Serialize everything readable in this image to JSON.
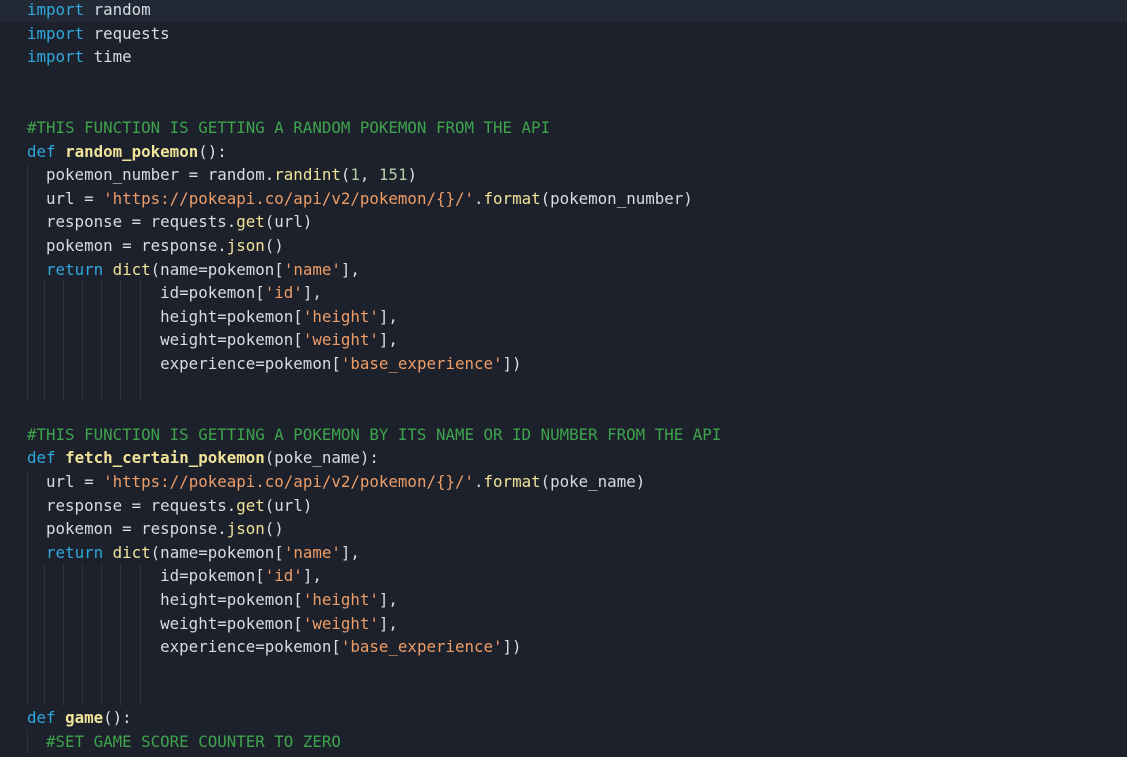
{
  "editor": {
    "lines": [
      [
        [
          "kw",
          "import"
        ],
        [
          "pl",
          " random"
        ]
      ],
      [
        [
          "kw",
          "import"
        ],
        [
          "pl",
          " requests"
        ]
      ],
      [
        [
          "kw",
          "import"
        ],
        [
          "pl",
          " time"
        ]
      ],
      [],
      [],
      [
        [
          "cmt",
          "#THIS FUNCTION IS GETTING A RANDOM POKEMON FROM THE API"
        ]
      ],
      [
        [
          "kw",
          "def"
        ],
        [
          "pl",
          " "
        ],
        [
          "fn",
          "random_pokemon"
        ],
        [
          "pl",
          "():"
        ]
      ],
      [
        [
          "pl",
          "  pokemon_number = random."
        ],
        [
          "meth",
          "randint"
        ],
        [
          "pl",
          "("
        ],
        [
          "num",
          "1"
        ],
        [
          "pl",
          ", "
        ],
        [
          "num",
          "151"
        ],
        [
          "pl",
          ")"
        ]
      ],
      [
        [
          "pl",
          "  url = "
        ],
        [
          "str",
          "'https://pokeapi.co/api/v2/pokemon/{}/'"
        ],
        [
          "pl",
          "."
        ],
        [
          "meth",
          "format"
        ],
        [
          "pl",
          "(pokemon_number)"
        ]
      ],
      [
        [
          "pl",
          "  response = requests."
        ],
        [
          "meth",
          "get"
        ],
        [
          "pl",
          "(url)"
        ]
      ],
      [
        [
          "pl",
          "  pokemon = response."
        ],
        [
          "meth",
          "json"
        ],
        [
          "pl",
          "()"
        ]
      ],
      [
        [
          "pl",
          "  "
        ],
        [
          "kw",
          "return"
        ],
        [
          "pl",
          " "
        ],
        [
          "meth",
          "dict"
        ],
        [
          "pl",
          "(name=pokemon["
        ],
        [
          "str",
          "'name'"
        ],
        [
          "pl",
          "],"
        ]
      ],
      [
        [
          "pl",
          "              id=pokemon["
        ],
        [
          "str",
          "'id'"
        ],
        [
          "pl",
          "],"
        ]
      ],
      [
        [
          "pl",
          "              height=pokemon["
        ],
        [
          "str",
          "'height'"
        ],
        [
          "pl",
          "],"
        ]
      ],
      [
        [
          "pl",
          "              weight=pokemon["
        ],
        [
          "str",
          "'weight'"
        ],
        [
          "pl",
          "],"
        ]
      ],
      [
        [
          "pl",
          "              experience=pokemon["
        ],
        [
          "str",
          "'base_experience'"
        ],
        [
          "pl",
          "])"
        ]
      ],
      [],
      [],
      [
        [
          "cmt",
          "#THIS FUNCTION IS GETTING A POKEMON BY ITS NAME OR ID NUMBER FROM THE API"
        ]
      ],
      [
        [
          "kw",
          "def"
        ],
        [
          "pl",
          " "
        ],
        [
          "fn",
          "fetch_certain_pokemon"
        ],
        [
          "pl",
          "(poke_name):"
        ]
      ],
      [
        [
          "pl",
          "  url = "
        ],
        [
          "str",
          "'https://pokeapi.co/api/v2/pokemon/{}/'"
        ],
        [
          "pl",
          "."
        ],
        [
          "meth",
          "format"
        ],
        [
          "pl",
          "(poke_name)"
        ]
      ],
      [
        [
          "pl",
          "  response = requests."
        ],
        [
          "meth",
          "get"
        ],
        [
          "pl",
          "(url)"
        ]
      ],
      [
        [
          "pl",
          "  pokemon = response."
        ],
        [
          "meth",
          "json"
        ],
        [
          "pl",
          "()"
        ]
      ],
      [
        [
          "pl",
          "  "
        ],
        [
          "kw",
          "return"
        ],
        [
          "pl",
          " "
        ],
        [
          "meth",
          "dict"
        ],
        [
          "pl",
          "(name=pokemon["
        ],
        [
          "str",
          "'name'"
        ],
        [
          "pl",
          "],"
        ]
      ],
      [
        [
          "pl",
          "              id=pokemon["
        ],
        [
          "str",
          "'id'"
        ],
        [
          "pl",
          "],"
        ]
      ],
      [
        [
          "pl",
          "              height=pokemon["
        ],
        [
          "str",
          "'height'"
        ],
        [
          "pl",
          "],"
        ]
      ],
      [
        [
          "pl",
          "              weight=pokemon["
        ],
        [
          "str",
          "'weight'"
        ],
        [
          "pl",
          "],"
        ]
      ],
      [
        [
          "pl",
          "              experience=pokemon["
        ],
        [
          "str",
          "'base_experience'"
        ],
        [
          "pl",
          "])"
        ]
      ],
      [],
      [],
      [
        [
          "kw",
          "def"
        ],
        [
          "pl",
          " "
        ],
        [
          "fn",
          "game"
        ],
        [
          "pl",
          "():"
        ]
      ],
      [
        [
          "pl",
          "  "
        ],
        [
          "cmt",
          "#SET GAME SCORE COUNTER TO ZERO"
        ]
      ]
    ]
  }
}
